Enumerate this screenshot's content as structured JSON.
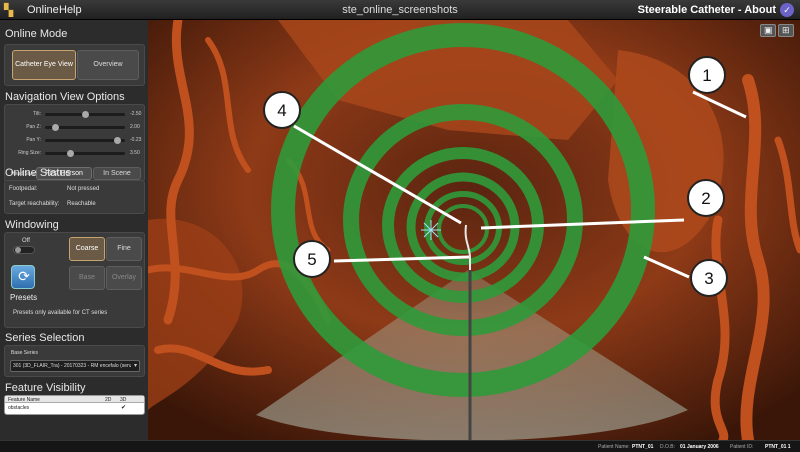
{
  "titlebar": {
    "menu_online": "Online",
    "menu_help": "Help",
    "window_title": "ste_online_screenshots",
    "brand": "Steerable Catheter - About"
  },
  "sidebar": {
    "online_mode": {
      "title": "Online Mode",
      "catheter_eye_view": "Catheter Eye View",
      "overview": "Overview"
    },
    "nav_options": {
      "title": "Navigation View Options",
      "sliders": [
        {
          "label": "Tilt:",
          "value": "-2.50",
          "fraction": 0.5
        },
        {
          "label": "Pan Z:",
          "value": "2.00",
          "fraction": 0.1
        },
        {
          "label": "Pan Y:",
          "value": "-0.23",
          "fraction": 0.95
        },
        {
          "label": "Ring Size:",
          "value": "3.50",
          "fraction": 0.3
        }
      ],
      "head_style_label": "Head Style",
      "first_person": "First Person",
      "in_scene": "In Scene"
    },
    "online_status": {
      "title": "Online Status",
      "footpedal_label": "Footpedal:",
      "footpedal_value": "Not pressed",
      "reach_label": "Target reachability:",
      "reach_value": "Reachable"
    },
    "windowing": {
      "title": "Windowing",
      "off_label": "Off",
      "coarse": "Coarse",
      "fine": "Fine",
      "base": "Base",
      "overlay": "Overlay",
      "presets_title": "Presets",
      "presets_note": "Presets only available for CT series"
    },
    "series_selection": {
      "title": "Series Selection",
      "base_series_label": "Base Series",
      "base_series_value": "301 (3D_FLAIR_Tra) - 20170323 - RM encefalo (senza e co"
    },
    "feature_visibility": {
      "title": "Feature Visibility",
      "col_name": "Feature Name",
      "col_2d": "2D",
      "col_3d": "3D",
      "rows": [
        {
          "name": "obstacles",
          "d2": "",
          "d3": "✔"
        }
      ]
    }
  },
  "viewport": {
    "callouts": [
      "1",
      "2",
      "3",
      "4",
      "5"
    ]
  },
  "statusbar": {
    "patient_name_label": "Patient Name:",
    "patient_name": "PTNT_01",
    "dob_label": "D.O.B:",
    "dob": "01 January 2006",
    "patient_id_label": "Patient ID:",
    "patient_id": "PTNT_01 1"
  },
  "colors": {
    "tissue": "#c0501e",
    "ring": "#2f9a3a",
    "accent": "#c8a470"
  },
  "icons": [
    "app-logo-icon",
    "about-icon",
    "refresh-icon",
    "view-mode-icon",
    "layout-icon"
  ]
}
